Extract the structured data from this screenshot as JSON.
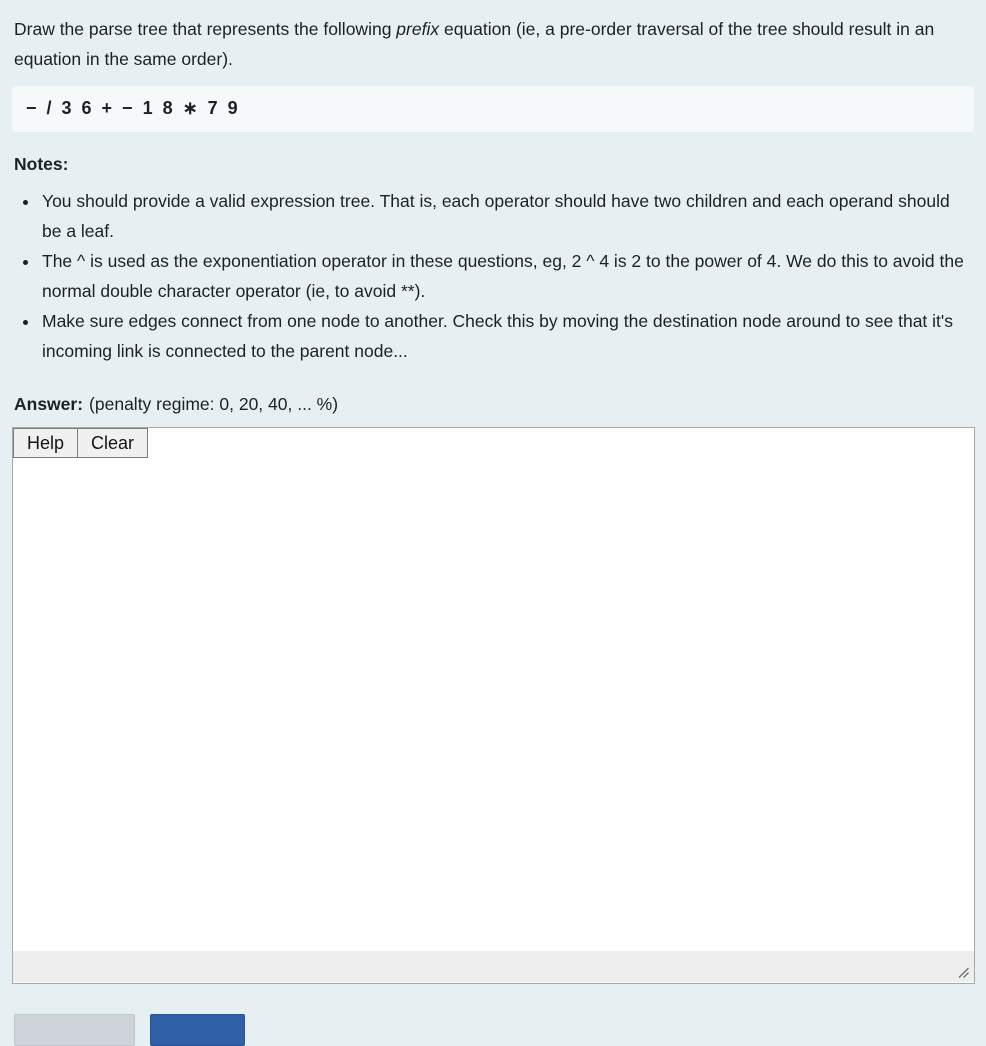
{
  "question": {
    "text_before_em": "Draw the parse tree that represents the following ",
    "em": "prefix",
    "text_after_em": " equation (ie, a pre-order traversal of the tree should result in an equation in the same order).",
    "equation": "− / 3 6 + − 1 8 ∗ 7 9"
  },
  "notes": {
    "heading": "Notes:",
    "items": [
      "You should provide a valid expression tree. That is, each operator should have two children and each operand should be a leaf.",
      "The ^ is used as the exponentiation operator in these questions, eg, 2 ^ 4 is 2 to the power of 4. We do this to avoid the normal double character operator (ie, to avoid **).",
      "Make sure edges connect from one node to another. Check this by moving the destination node around to see that it's incoming link is connected to the parent node..."
    ]
  },
  "answer": {
    "label": "Answer:",
    "penalty": "(penalty regime: 0, 20, 40, ... %)",
    "toolbar": {
      "help_label": "Help",
      "clear_label": "Clear"
    },
    "canvas_content": ""
  },
  "bottom_actions": {
    "secondary_label": "",
    "primary_label": ""
  },
  "colors": {
    "page_background": "#e6eff1",
    "equation_background": "#f5f9fa",
    "panel_border": "#a8a8a8",
    "panel_footer": "#eeeeee",
    "primary_button": "#3060a8",
    "secondary_button": "#ced4d9",
    "text": "#1d2125"
  }
}
